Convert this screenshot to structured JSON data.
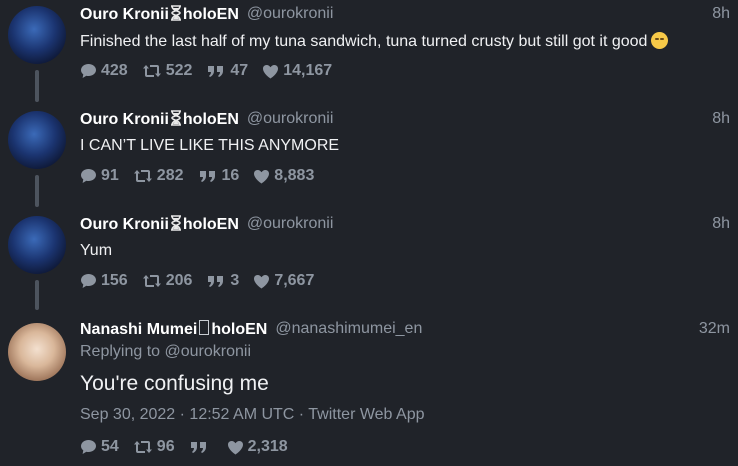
{
  "thread": [
    {
      "author": {
        "name_prefix": "Ouro Kronii",
        "name_suffix": "holoEN",
        "handle": "@ourokronii",
        "avatar_icon": "kronii-avatar"
      },
      "time": "8h",
      "text": "Finished the last half of my tuna sandwich, tuna turned crusty but still got it good",
      "emoji": "grinning-face-emoji",
      "stats": {
        "replies": "428",
        "retweets": "522",
        "quotes": "47",
        "likes": "14,167"
      }
    },
    {
      "author": {
        "name_prefix": "Ouro Kronii",
        "name_suffix": "holoEN",
        "handle": "@ourokronii",
        "avatar_icon": "kronii-avatar"
      },
      "time": "8h",
      "text": "I CAN’T LIVE LIKE THIS ANYMORE",
      "stats": {
        "replies": "91",
        "retweets": "282",
        "quotes": "16",
        "likes": "8,883"
      }
    },
    {
      "author": {
        "name_prefix": "Ouro Kronii",
        "name_suffix": "holoEN",
        "handle": "@ourokronii",
        "avatar_icon": "kronii-avatar"
      },
      "time": "8h",
      "text": "Yum",
      "stats": {
        "replies": "156",
        "retweets": "206",
        "quotes": "3",
        "likes": "7,667"
      }
    }
  ],
  "main": {
    "author": {
      "name_prefix": "Nanashi Mumei",
      "name_suffix": "holoEN",
      "handle": "@nanashimumei_en",
      "avatar_icon": "mumei-avatar"
    },
    "time": "32m",
    "replying_prefix": "Replying to",
    "replying_handle": "@ourokronii",
    "text": "You're confusing me",
    "date": "Sep 30, 2022 · 12:52 AM UTC",
    "separator": "·",
    "source": "Twitter Web App",
    "stats": {
      "replies": "54",
      "retweets": "96",
      "quotes": "",
      "likes": "2,318"
    }
  },
  "colors": {
    "background": "#202329",
    "muted": "#8e96a1",
    "text": "#f0f1f3"
  }
}
